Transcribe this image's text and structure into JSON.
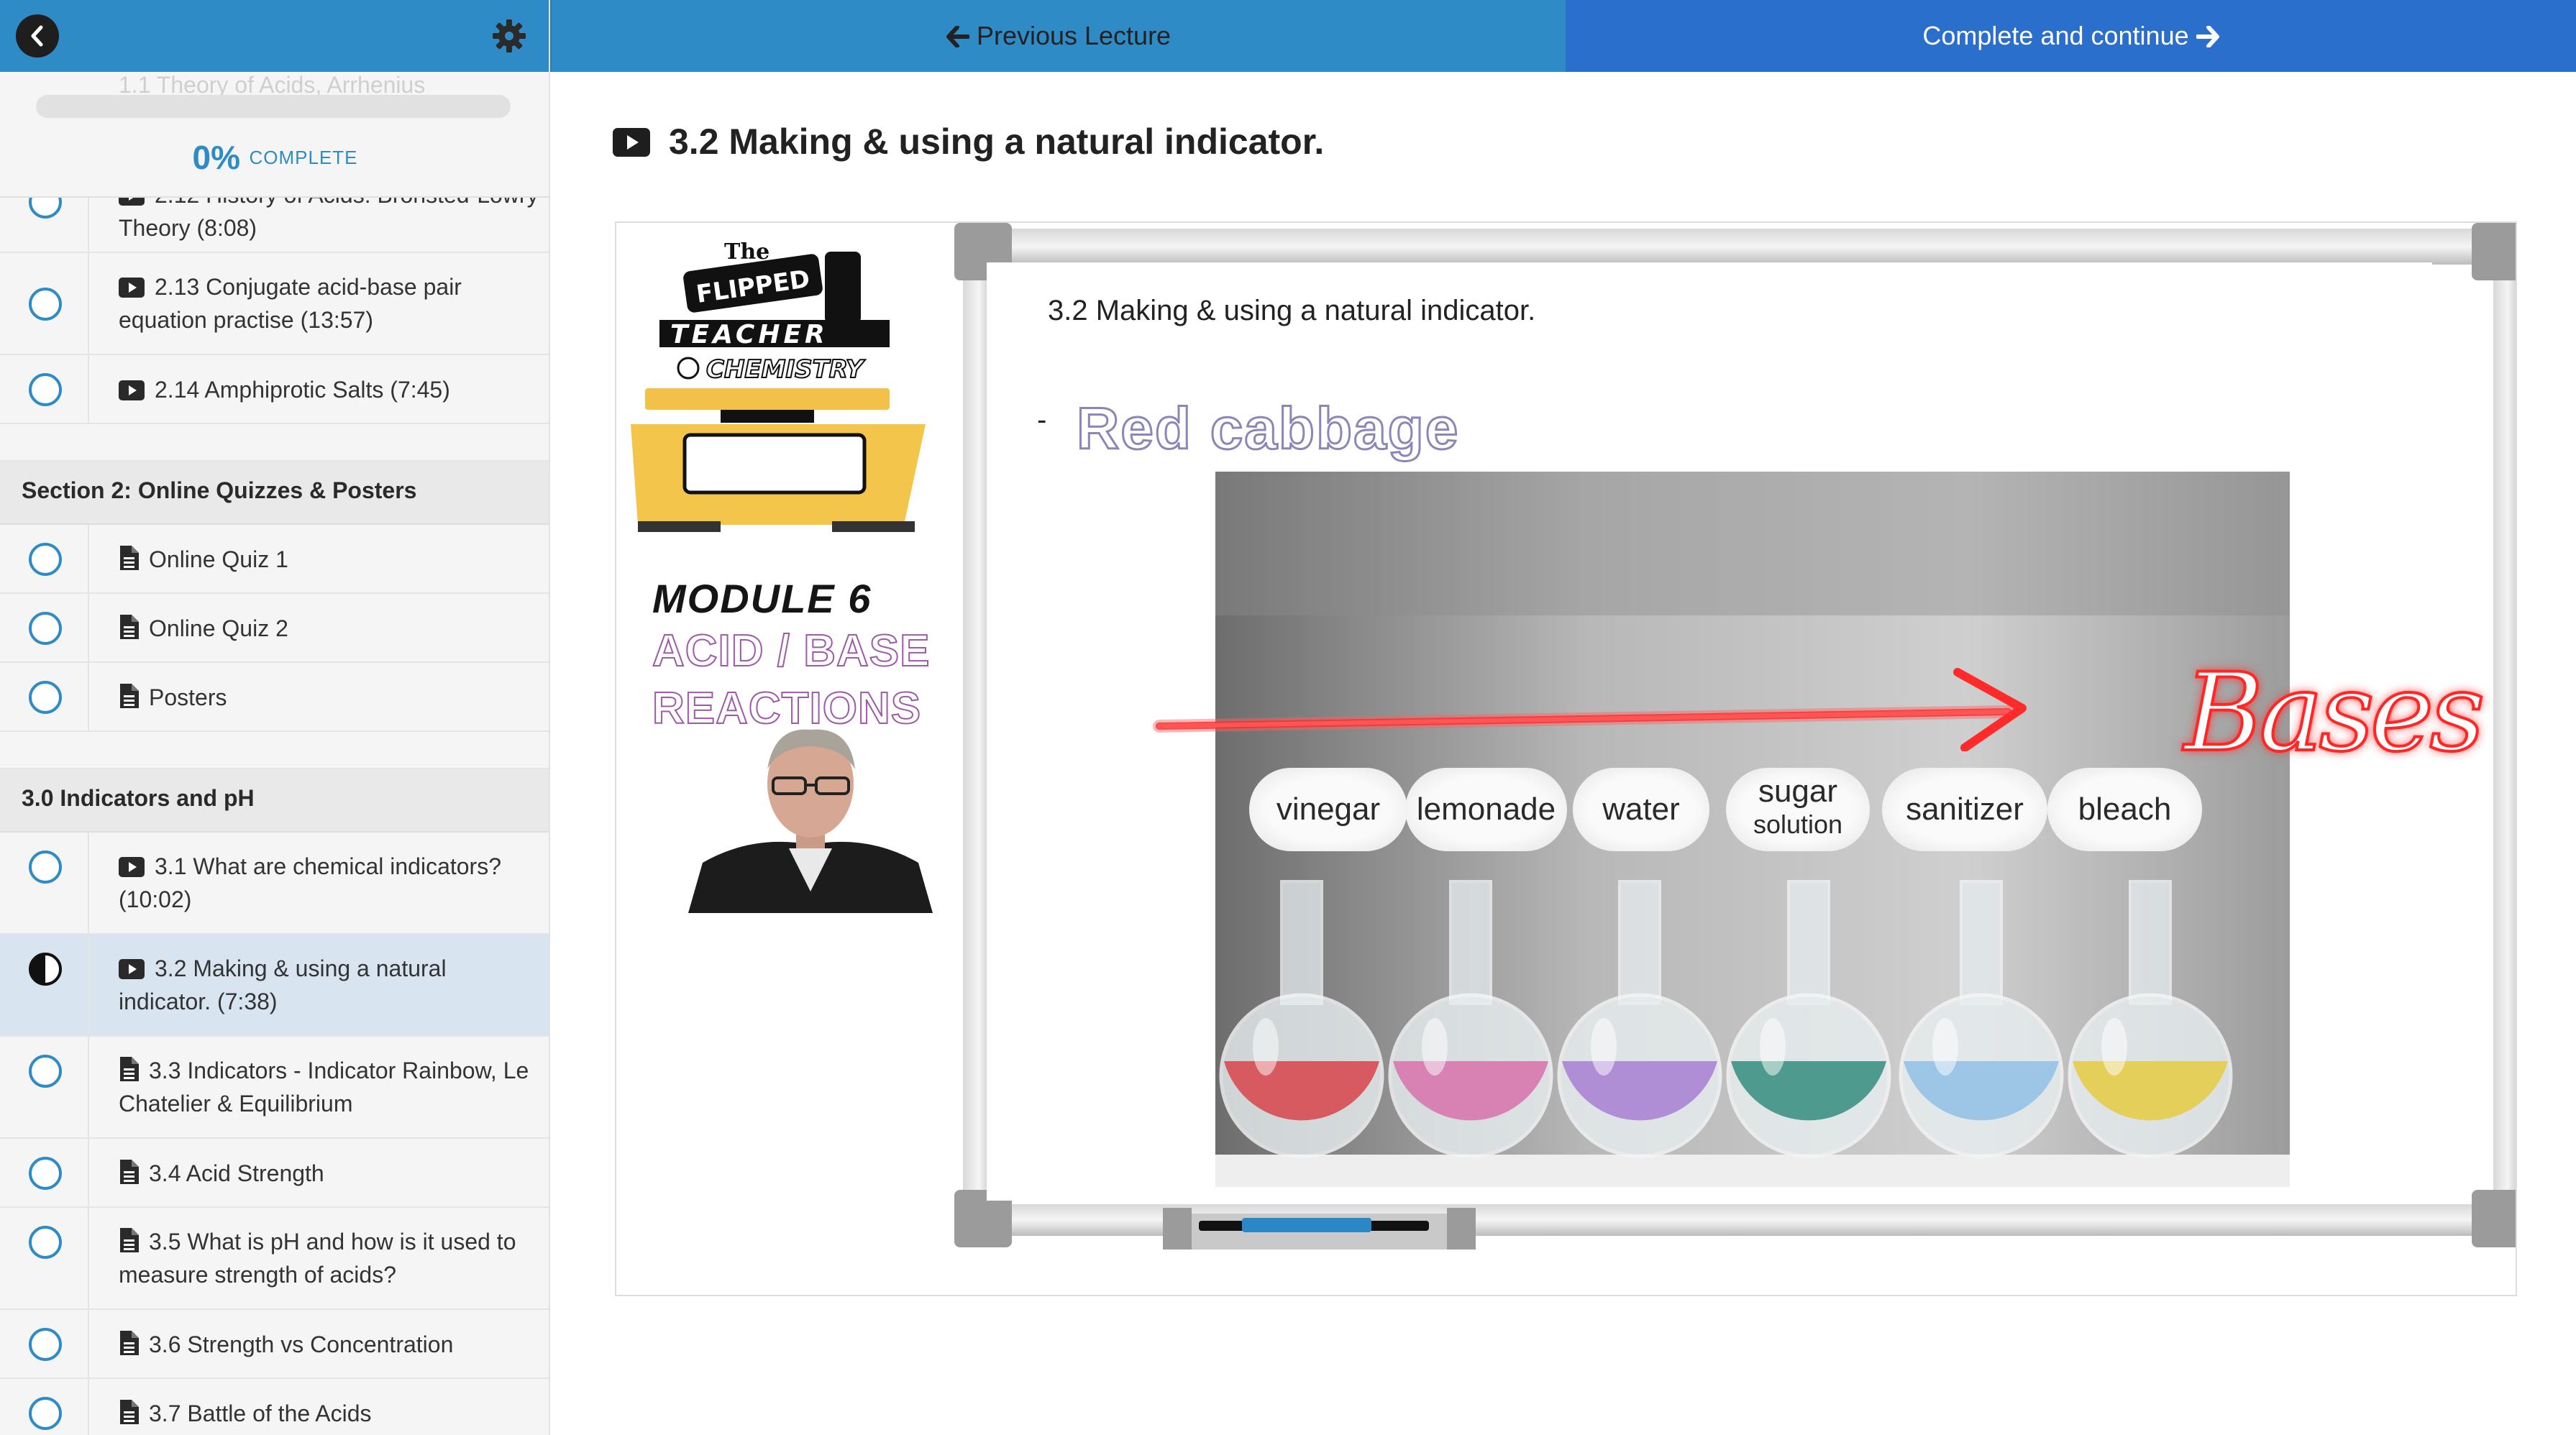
{
  "sidebar": {
    "progress_ghost_text": "1.1 Theory of Acids, Arrhenius",
    "progress_percent": "0%",
    "progress_label": "COMPLETE",
    "progress_fraction": 0,
    "top_rows": [
      {
        "text": "2.12 History of Acids: Bronsted-Lowry Theory (8:08)",
        "icon": "play-icon"
      },
      {
        "text": "2.13 Conjugate acid-base pair equation practise (13:57)",
        "icon": "play-icon"
      },
      {
        "text": "2.14 Amphiprotic Salts (7:45)",
        "icon": "play-icon"
      }
    ],
    "section2_title": "Section 2: Online Quizzes & Posters",
    "section2_rows": [
      {
        "text": "Online Quiz 1",
        "icon": "document-icon"
      },
      {
        "text": "Online Quiz 2",
        "icon": "document-icon"
      },
      {
        "text": "Posters",
        "icon": "document-icon"
      }
    ],
    "section3_title": "3.0 Indicators and pH",
    "section3_rows": [
      {
        "text": "3.1 What are chemical indicators? (10:02)",
        "icon": "play-icon"
      },
      {
        "text": "3.2 Making & using a natural indicator. (7:38)",
        "icon": "play-icon",
        "active": true
      },
      {
        "text": "3.3 Indicators - Indicator Rainbow, Le Chatelier & Equilibrium",
        "icon": "document-icon"
      },
      {
        "text": "3.4 Acid Strength",
        "icon": "document-icon"
      },
      {
        "text": "3.5 What is pH and how is it used to measure strength of acids?",
        "icon": "document-icon"
      },
      {
        "text": "3.6 Strength vs Concentration",
        "icon": "document-icon"
      },
      {
        "text": "3.7 Battle of the Acids",
        "icon": "document-icon"
      }
    ]
  },
  "topbar": {
    "prev_label": "Previous Lecture",
    "next_label": "Complete and continue"
  },
  "lecture": {
    "title": "3.2 Making & using a natural indicator."
  },
  "video": {
    "logo_line1": "The",
    "logo_line2": "FLIPPED",
    "logo_line3": "TEACHER",
    "logo_line4": "CHEMISTRY",
    "module_line1": "MODULE 6",
    "module_line2": "ACID / BASE",
    "module_line3": "REACTIONS",
    "slide_title": "3.2 Making & using a natural indicator.",
    "slide_dash": "-",
    "slide_handwritten": "Red cabbage",
    "arrow_label": "Bases",
    "beaker_labels": [
      {
        "text": "vinegar",
        "sub": ""
      },
      {
        "text": "lemonade",
        "sub": ""
      },
      {
        "text": "water",
        "sub": ""
      },
      {
        "text": "sugar",
        "sub": "solution"
      },
      {
        "text": "sanitizer",
        "sub": ""
      },
      {
        "text": "bleach",
        "sub": ""
      }
    ],
    "flask_colors": [
      "#d65a5f",
      "#d782b3",
      "#b08ed6",
      "#4e9a8e",
      "#9cc5e6",
      "#e3cf5a"
    ]
  },
  "colors": {
    "accent": "#2f8bc6",
    "next_button": "#2a6fcb",
    "active_row": "#d8e5f1"
  }
}
